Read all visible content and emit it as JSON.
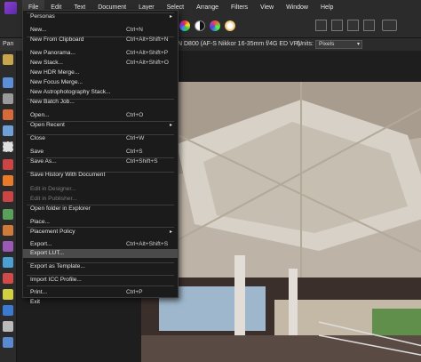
{
  "menubar": {
    "items": [
      "File",
      "Edit",
      "Text",
      "Document",
      "Layer",
      "Select",
      "Arrange",
      "Filters",
      "View",
      "Window",
      "Help"
    ]
  },
  "context": {
    "panel_tab": "Pan",
    "camera": "N D800 (AF-S Nikkor 16-35mm f/4G ED VR)",
    "units_label": "Units:",
    "units_value": "Pixels"
  },
  "file_menu": {
    "items": [
      {
        "label": "Personas",
        "shortcut": "",
        "submenu": true,
        "disabled": false
      },
      {
        "label": "New...",
        "shortcut": "Ctrl+N",
        "submenu": false,
        "disabled": false
      },
      {
        "label": "New From Clipboard",
        "shortcut": "Ctrl+Alt+Shift+N",
        "submenu": false,
        "disabled": false
      },
      {
        "label": "New Panorama...",
        "shortcut": "Ctrl+Alt+Shift+P",
        "submenu": false,
        "disabled": false
      },
      {
        "label": "New Stack...",
        "shortcut": "Ctrl+Alt+Shift+O",
        "submenu": false,
        "disabled": false
      },
      {
        "label": "New HDR Merge...",
        "shortcut": "",
        "submenu": false,
        "disabled": false
      },
      {
        "label": "New Focus Merge...",
        "shortcut": "",
        "submenu": false,
        "disabled": false
      },
      {
        "label": "New Astrophotography Stack...",
        "shortcut": "",
        "submenu": false,
        "disabled": false
      },
      {
        "label": "New Batch Job...",
        "shortcut": "",
        "submenu": false,
        "disabled": false
      },
      {
        "label": "Open...",
        "shortcut": "Ctrl+O",
        "submenu": false,
        "disabled": false
      },
      {
        "label": "Open Recent",
        "shortcut": "",
        "submenu": true,
        "disabled": false
      },
      {
        "label": "Close",
        "shortcut": "Ctrl+W",
        "submenu": false,
        "disabled": false
      },
      {
        "label": "Save",
        "shortcut": "Ctrl+S",
        "submenu": false,
        "disabled": false
      },
      {
        "label": "Save As...",
        "shortcut": "Ctrl+Shift+S",
        "submenu": false,
        "disabled": false
      },
      {
        "label": "Save History With Document",
        "shortcut": "",
        "submenu": false,
        "disabled": false
      },
      {
        "label": "Edit in Designer...",
        "shortcut": "",
        "submenu": false,
        "disabled": true
      },
      {
        "label": "Edit in Publisher...",
        "shortcut": "",
        "submenu": false,
        "disabled": true
      },
      {
        "label": "Open folder in Explorer",
        "shortcut": "",
        "submenu": false,
        "disabled": false
      },
      {
        "label": "Place...",
        "shortcut": "",
        "submenu": false,
        "disabled": false
      },
      {
        "label": "Placement Policy",
        "shortcut": "",
        "submenu": true,
        "disabled": false
      },
      {
        "label": "Export...",
        "shortcut": "Ctrl+Alt+Shift+S",
        "submenu": false,
        "disabled": false
      },
      {
        "label": "Export LUT...",
        "shortcut": "",
        "submenu": false,
        "disabled": false,
        "highlighted": true
      },
      {
        "label": "Export as Template...",
        "shortcut": "",
        "submenu": false,
        "disabled": false
      },
      {
        "label": "Import ICC Profile...",
        "shortcut": "",
        "submenu": false,
        "disabled": false
      },
      {
        "label": "Print...",
        "shortcut": "Ctrl+P",
        "submenu": false,
        "disabled": false
      },
      {
        "label": "Exit",
        "shortcut": "",
        "submenu": false,
        "disabled": false
      }
    ]
  },
  "colors": {
    "accent": "#8e3fd0",
    "menu_bg": "#1b1b1b",
    "highlight_bg": "#4a4a4a"
  }
}
